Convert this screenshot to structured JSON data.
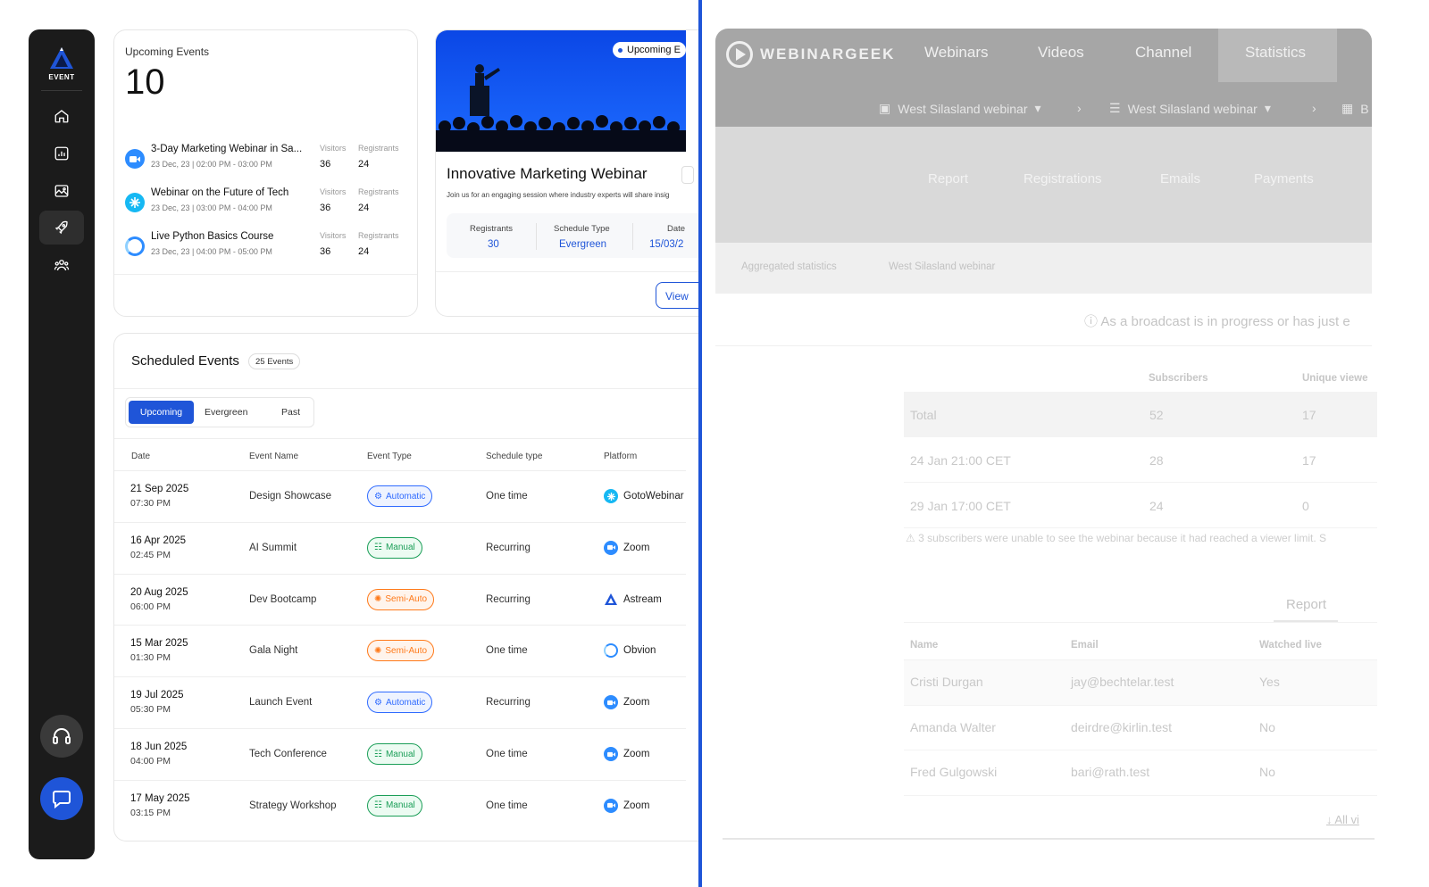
{
  "sidebar": {
    "logo_text": "EVENT",
    "items": [
      {
        "icon": "home-icon"
      },
      {
        "icon": "chart-icon"
      },
      {
        "icon": "image-icon"
      },
      {
        "icon": "rocket-icon",
        "active": true
      },
      {
        "icon": "users-icon"
      }
    ],
    "support_icon": "headset-icon",
    "chat_icon": "chat-icon"
  },
  "upcoming_card": {
    "label": "Upcoming Events",
    "count": "10",
    "events": [
      {
        "title": "3-Day Marketing Webinar in Sa...",
        "date": "23 Dec, 23 | 02:00 PM - 03:00 PM",
        "visitors_label": "Visitors",
        "registrants_label": "Registrants",
        "visitors": "36",
        "registrants": "24",
        "platform_icon": "zoom-icon"
      },
      {
        "title": "Webinar on the Future of Tech",
        "date": "23 Dec, 23 | 03:00 PM - 04:00 PM",
        "visitors_label": "Visitors",
        "registrants_label": "Registrants",
        "visitors": "36",
        "registrants": "24",
        "platform_icon": "gotowebinar-icon"
      },
      {
        "title": "Live Python Basics Course",
        "date": "23 Dec, 23 | 04:00 PM - 05:00 PM",
        "visitors_label": "Visitors",
        "registrants_label": "Registrants",
        "visitors": "36",
        "registrants": "24",
        "platform_icon": "obvion-icon"
      }
    ]
  },
  "feature_card": {
    "badge": "Upcoming E",
    "title": "Innovative Marketing Webinar",
    "description": "Join us for an engaging session where industry experts will share insig",
    "stats": [
      {
        "label": "Registrants",
        "value": "30"
      },
      {
        "label": "Schedule Type",
        "value": "Evergreen"
      },
      {
        "label": "Date",
        "value": "15/03/2"
      }
    ],
    "view_button": "View"
  },
  "scheduled": {
    "title": "Scheduled Events",
    "count_badge": "25 Events",
    "tabs": [
      {
        "label": "Upcoming",
        "active": true
      },
      {
        "label": "Evergreen",
        "active": false
      },
      {
        "label": "Past",
        "active": false
      }
    ],
    "columns": [
      "Date",
      "Event Name",
      "Event Type",
      "Schedule type",
      "Platform"
    ],
    "rows": [
      {
        "date": "21 Sep 2025",
        "time": "07:30 PM",
        "name": "Design Showcase",
        "type": "Automatic",
        "type_class": "b-auto",
        "schedule": "One time",
        "platform": "GotoWebinar",
        "platform_icon": "gotowebinar-icon"
      },
      {
        "date": "16 Apr 2025",
        "time": "02:45 PM",
        "name": "AI Summit",
        "type": "Manual",
        "type_class": "b-manual",
        "schedule": "Recurring",
        "platform": "Zoom",
        "platform_icon": "zoom-icon"
      },
      {
        "date": "20 Aug 2025",
        "time": "06:00 PM",
        "name": "Dev Bootcamp",
        "type": "Semi-Auto",
        "type_class": "b-semi",
        "schedule": "Recurring",
        "platform": "Astream",
        "platform_icon": "astream-icon"
      },
      {
        "date": "15 Mar 2025",
        "time": "01:30 PM",
        "name": "Gala Night",
        "type": "Semi-Auto",
        "type_class": "b-semi",
        "schedule": "One time",
        "platform": "Obvion",
        "platform_icon": "obvion-icon"
      },
      {
        "date": "19 Jul 2025",
        "time": "05:30 PM",
        "name": "Launch Event",
        "type": "Automatic",
        "type_class": "b-auto",
        "schedule": "Recurring",
        "platform": "Zoom",
        "platform_icon": "zoom-icon"
      },
      {
        "date": "18 Jun 2025",
        "time": "04:00 PM",
        "name": "Tech Conference",
        "type": "Manual",
        "type_class": "b-manual",
        "schedule": "One time",
        "platform": "Zoom",
        "platform_icon": "zoom-icon"
      },
      {
        "date": "17 May 2025",
        "time": "03:15 PM",
        "name": "Strategy Workshop",
        "type": "Manual",
        "type_class": "b-manual",
        "schedule": "One time",
        "platform": "Zoom",
        "platform_icon": "zoom-icon"
      }
    ]
  },
  "webinargeek": {
    "brand": "WEBINARGEEK",
    "nav": [
      "Webinars",
      "Videos",
      "Channel",
      "Statistics"
    ],
    "breadcrumb": [
      "West Silasland webinar",
      "West Silasland webinar",
      "B"
    ],
    "subnav": [
      "Report",
      "Registrations",
      "Emails",
      "Payments"
    ],
    "crumbs": [
      "Aggregated statistics",
      "West Silasland webinar"
    ],
    "notice": "As a broadcast is in progress or has just e",
    "stats_columns": [
      "Subscribers",
      "Unique viewe"
    ],
    "stats_rows": [
      {
        "label": "Total",
        "subscribers": "52",
        "viewers": "17"
      },
      {
        "label": "24 Jan 21:00 CET",
        "subscribers": "28",
        "viewers": "17"
      },
      {
        "label": "29 Jan 17:00 CET",
        "subscribers": "24",
        "viewers": "0"
      }
    ],
    "warning": "3 subscribers were unable to see the webinar because it had reached a viewer limit. S",
    "report_tab": "Report",
    "people_columns": [
      "Name",
      "Email",
      "Watched live"
    ],
    "people": [
      {
        "name": "Cristi Durgan",
        "email": "jay@bechtelar.test",
        "watched": "Yes"
      },
      {
        "name": "Amanda Walter",
        "email": "deirdre@kirlin.test",
        "watched": "No"
      },
      {
        "name": "Fred Gulgowski",
        "email": "bari@rath.test",
        "watched": "No"
      }
    ],
    "all_link": "All vi"
  }
}
